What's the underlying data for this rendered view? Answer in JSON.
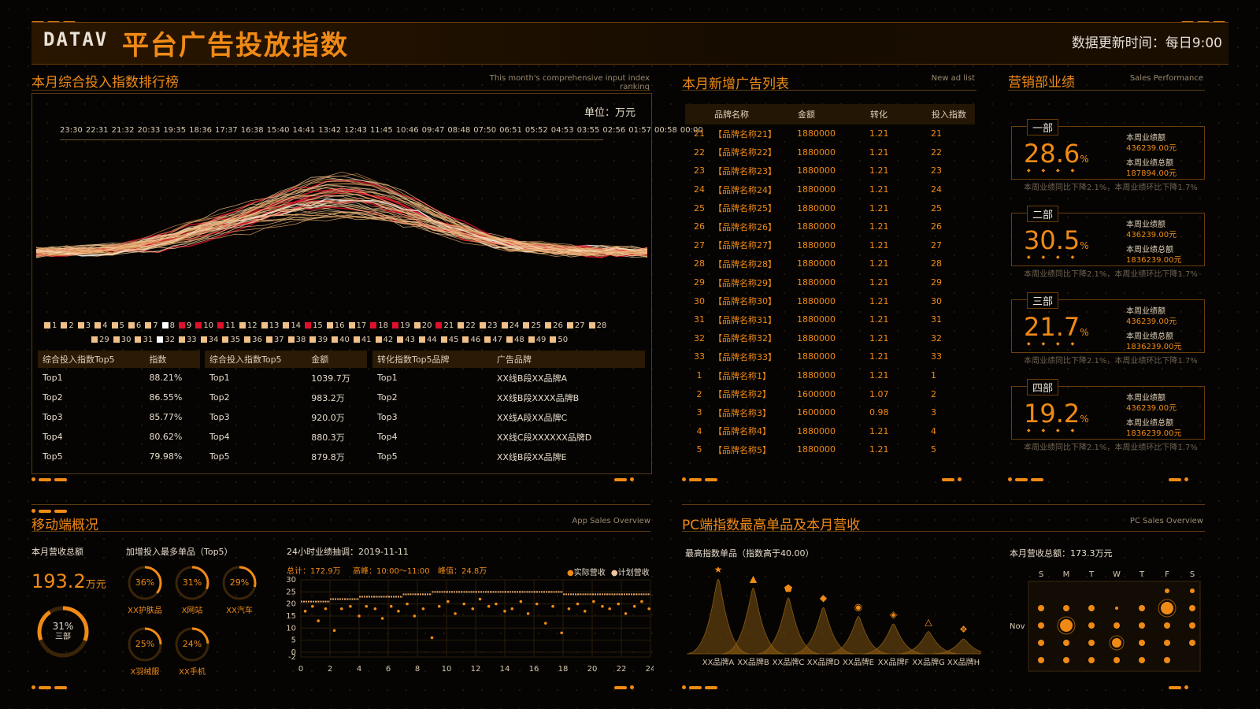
{
  "header": {
    "logo": "DATAV",
    "title": "平台广告投放指数",
    "update_label": "数据更新时间：每日9:00"
  },
  "ranking_panel": {
    "title": "本月综合投入指数排行榜",
    "subtitle": "This month's comprehensive input index ranking",
    "unit": "单位：万元",
    "time_ticks": [
      "23:30",
      "22:31",
      "21:32",
      "20:33",
      "19:35",
      "18:36",
      "17:37",
      "16:38",
      "15:40",
      "14:41",
      "13:42",
      "12:43",
      "11:45",
      "10:46",
      "09:47",
      "08:48",
      "07:50",
      "06:51",
      "05:52",
      "04:53",
      "03:55",
      "02:56",
      "01:57",
      "00:58",
      "00:00"
    ],
    "legend_row1": [
      "1",
      "2",
      "3",
      "4",
      "5",
      "6",
      "7",
      "8",
      "9",
      "10",
      "11",
      "12",
      "13",
      "14",
      "15",
      "16",
      "17",
      "18",
      "19",
      "20",
      "21",
      "22",
      "23",
      "24",
      "25",
      "26",
      "27",
      "28"
    ],
    "legend_row2": [
      "29",
      "30",
      "31",
      "32",
      "33",
      "34",
      "35",
      "36",
      "37",
      "38",
      "39",
      "40",
      "41",
      "42",
      "43",
      "44",
      "45",
      "46",
      "47",
      "48",
      "49",
      "50"
    ],
    "table1_headers": [
      "综合投入指数Top5",
      "指数"
    ],
    "table1_rows": [
      [
        "Top1",
        "88.21%"
      ],
      [
        "Top2",
        "86.55%"
      ],
      [
        "Top3",
        "85.77%"
      ],
      [
        "Top4",
        "80.62%"
      ],
      [
        "Top5",
        "79.98%"
      ]
    ],
    "table2_headers": [
      "综合投入指数Top5",
      "金额"
    ],
    "table2_rows": [
      [
        "Top1",
        "1039.7万"
      ],
      [
        "Top2",
        "983.2万"
      ],
      [
        "Top3",
        "920.0万"
      ],
      [
        "Top4",
        "880.3万"
      ],
      [
        "Top5",
        "879.8万"
      ]
    ],
    "table3_headers": [
      "转化指数Top5品牌",
      "广告品牌"
    ],
    "table3_rows": [
      [
        "Top1",
        "XX线B段XX品牌A"
      ],
      [
        "Top2",
        "XX线B段XXXX品牌B"
      ],
      [
        "Top3",
        "XX线A段XX品牌C"
      ],
      [
        "Top4",
        "XX线C段XXXXXX品牌D"
      ],
      [
        "Top5",
        "XX线B段XX品牌E"
      ]
    ]
  },
  "adlist_panel": {
    "title": "本月新增广告列表",
    "subtitle": "New ad list",
    "headers": [
      "品牌名称",
      "金额",
      "转化",
      "投入指数"
    ],
    "rows": [
      [
        "21",
        "【品牌名称21】",
        "1880000",
        "1.21",
        "21"
      ],
      [
        "22",
        "【品牌名称22】",
        "1880000",
        "1.21",
        "22"
      ],
      [
        "23",
        "【品牌名称23】",
        "1880000",
        "1.21",
        "23"
      ],
      [
        "24",
        "【品牌名称24】",
        "1880000",
        "1.21",
        "24"
      ],
      [
        "25",
        "【品牌名称25】",
        "1880000",
        "1.21",
        "25"
      ],
      [
        "26",
        "【品牌名称26】",
        "1880000",
        "1.21",
        "26"
      ],
      [
        "27",
        "【品牌名称27】",
        "1880000",
        "1.21",
        "27"
      ],
      [
        "28",
        "【品牌名称28】",
        "1880000",
        "1.21",
        "28"
      ],
      [
        "29",
        "【品牌名称29】",
        "1880000",
        "1.21",
        "29"
      ],
      [
        "30",
        "【品牌名称30】",
        "1880000",
        "1.21",
        "30"
      ],
      [
        "31",
        "【品牌名称31】",
        "1880000",
        "1.21",
        "31"
      ],
      [
        "32",
        "【品牌名称32】",
        "1880000",
        "1.21",
        "32"
      ],
      [
        "33",
        "【品牌名称33】",
        "1880000",
        "1.21",
        "33"
      ],
      [
        "1",
        "【品牌名称1】",
        "1880000",
        "1.21",
        "1"
      ],
      [
        "2",
        "【品牌名称2】",
        "1600000",
        "1.07",
        "2"
      ],
      [
        "3",
        "【品牌名称3】",
        "1600000",
        "0.98",
        "3"
      ],
      [
        "4",
        "【品牌名称4】",
        "1880000",
        "1.21",
        "4"
      ],
      [
        "5",
        "【品牌名称5】",
        "1880000",
        "1.21",
        "5"
      ]
    ]
  },
  "sales_panel": {
    "title": "营销部业绩",
    "subtitle": "Sales Performance",
    "week_label": "本周业绩额",
    "total_label": "本周业绩总额",
    "units": [
      {
        "name": "一部",
        "pct": "28.6",
        "pct_unit": "%",
        "week_val": "436239.00元",
        "total_val": "187894.00元",
        "foot": "本周业绩同比下降2.1%，本周业绩环比下降1.7%"
      },
      {
        "name": "二部",
        "pct": "30.5",
        "pct_unit": "%",
        "week_val": "436239.00元",
        "total_val": "1836239.00元",
        "foot": "本周业绩同比下降2.1%，本周业绩环比下降1.7%"
      },
      {
        "name": "三部",
        "pct": "21.7",
        "pct_unit": "%",
        "week_val": "436239.00元",
        "total_val": "1836239.00元",
        "foot": "本周业绩同比下降2.1%，本周业绩环比下降1.7%"
      },
      {
        "name": "四部",
        "pct": "19.2",
        "pct_unit": "%",
        "week_val": "436239.00元",
        "total_val": "1836239.00元",
        "foot": "本周业绩同比下降2.1%，本周业绩环比下降1.7%"
      }
    ]
  },
  "mobile_panel": {
    "title": "移动端概况",
    "subtitle": "App Sales Overview",
    "revenue_label": "本月营收总额",
    "revenue_value": "193.2",
    "revenue_unit": "万元",
    "main_ring": {
      "pct": "31%",
      "label": "三部",
      "fraction": 0.31
    },
    "top5_label": "加增投入最多单品（Top5）",
    "top5": [
      {
        "pct": "36%",
        "label": "XX护肤品",
        "fraction": 0.36
      },
      {
        "pct": "31%",
        "label": "X网站",
        "fraction": 0.31
      },
      {
        "pct": "29%",
        "label": "XX汽车",
        "fraction": 0.29
      },
      {
        "pct": "25%",
        "label": "X羽绒服",
        "fraction": 0.25
      },
      {
        "pct": "24%",
        "label": "XX手机",
        "fraction": 0.24
      }
    ],
    "h24_label": "24小时业绩抽调：2019-11-11",
    "h24_stats": {
      "total": "总计：172.9万",
      "peak_time": "高峰：10:00～11:00",
      "peak": "峰值：24.8万"
    },
    "legend": [
      "实际营收",
      "计划营收"
    ]
  },
  "pc_panel": {
    "title": "PC端指数最高单品及本月营收",
    "subtitle": "PC Sales Overview",
    "left_label": "最高指数单品（指数高于40.00）",
    "right_label": "本月营收总额：173.3万元",
    "brands": [
      "XX品牌A",
      "XX品牌B",
      "XX品牌C",
      "XX品牌D",
      "XX品牌E",
      "XX品牌F",
      "XX品牌G",
      "XX品牌H"
    ],
    "calendar_days": [
      "S",
      "M",
      "T",
      "W",
      "T",
      "F",
      "S"
    ],
    "calendar_month": "Nov"
  },
  "colors": {
    "accent": "#f08a16",
    "dark_accent": "#6a3b06",
    "text": "#e8dccb"
  },
  "chart_data": [
    {
      "type": "scatter",
      "title": "24小时业绩抽调：2019-11-11",
      "xlim": [
        0,
        24
      ],
      "ylim": [
        -2,
        30
      ],
      "xticks": [
        "0",
        "2",
        "4",
        "6",
        "8",
        "10",
        "12",
        "14",
        "16",
        "18",
        "20",
        "22",
        "24"
      ],
      "yticks": [
        "30",
        "25",
        "20",
        "15",
        "10",
        "5",
        "0",
        "-2"
      ],
      "series": [
        {
          "name": "实际营收",
          "x": [
            0.3,
            0.8,
            1.2,
            1.7,
            2.3,
            2.8,
            3.4,
            4.0,
            4.5,
            5.1,
            5.6,
            6.2,
            6.7,
            7.3,
            7.8,
            8.4,
            9.0,
            9.5,
            10.1,
            10.6,
            11.2,
            11.8,
            12.3,
            12.9,
            13.4,
            14.0,
            14.5,
            15.1,
            15.6,
            16.2,
            16.8,
            17.3,
            17.9,
            18.4,
            19.0,
            19.5,
            20.1,
            20.7,
            21.2,
            21.8,
            22.3,
            22.9,
            23.4,
            23.9
          ],
          "y": [
            17,
            19,
            13,
            18,
            9,
            18,
            19,
            15,
            19,
            18,
            14,
            19,
            17,
            20,
            15,
            18,
            6,
            19,
            21,
            16,
            20,
            18,
            22,
            19,
            20,
            17,
            18,
            21,
            16,
            20,
            12,
            19,
            8,
            18,
            20,
            17,
            21,
            19,
            18,
            20,
            16,
            19,
            21,
            18
          ]
        },
        {
          "name": "计划营收",
          "x": [
            0,
            1,
            2,
            3,
            4,
            5,
            6,
            7,
            8,
            9,
            10,
            11,
            12,
            13,
            14,
            15,
            16,
            17,
            18,
            19,
            20,
            21,
            22,
            23,
            24
          ],
          "y": [
            21,
            21,
            22,
            22,
            23,
            23,
            23,
            24,
            24,
            25,
            25,
            25,
            25,
            25,
            25,
            25,
            25,
            25,
            24,
            24,
            24,
            24,
            24,
            24,
            24
          ]
        }
      ]
    },
    {
      "type": "area",
      "title": "最高指数单品（指数高于40.00）",
      "categories": [
        "XX品牌A",
        "XX品牌B",
        "XX品牌C",
        "XX品牌D",
        "XX品牌E",
        "XX品牌F",
        "XX品牌G",
        "XX品牌H"
      ],
      "values": [
        100,
        88,
        75,
        62,
        50,
        40,
        30,
        20
      ]
    }
  ]
}
